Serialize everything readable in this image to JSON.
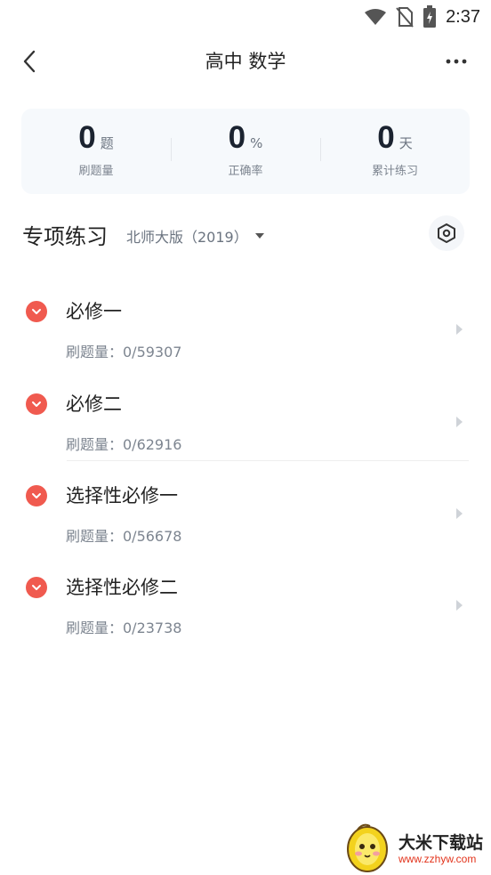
{
  "status_bar": {
    "time": "2:37"
  },
  "header": {
    "title": "高中 数学"
  },
  "stats": [
    {
      "value": "0",
      "unit": "题",
      "label": "刷题量"
    },
    {
      "value": "0",
      "unit": "%",
      "label": "正确率"
    },
    {
      "value": "0",
      "unit": "天",
      "label": "累计练习"
    }
  ],
  "section": {
    "title": "专项练习",
    "edition": "北师大版（2019）"
  },
  "items": [
    {
      "name": "必修一",
      "count": "刷题量：0/59307"
    },
    {
      "name": "必修二",
      "count": "刷题量：0/62916"
    },
    {
      "name": "选择性必修一",
      "count": "刷题量：0/56678"
    },
    {
      "name": "选择性必修二",
      "count": "刷题量：0/23738"
    }
  ],
  "watermark": {
    "text": "大米下载站",
    "url": "www.zzhyw.com"
  },
  "colors": {
    "accent": "#f05a4f",
    "stats_bg": "#f6f9fc",
    "highlight": "#ffd6d6"
  }
}
